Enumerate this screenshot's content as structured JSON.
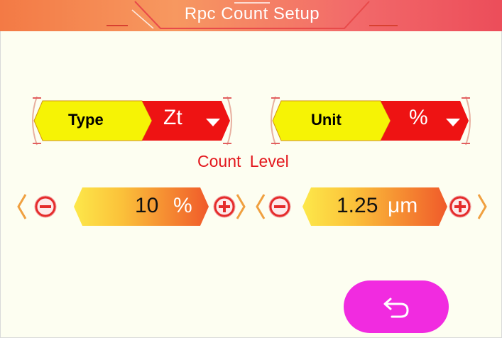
{
  "header": {
    "title": "Rpc  Count  Setup"
  },
  "type_selector": {
    "label": "Type",
    "value": "Zt"
  },
  "unit_selector": {
    "label": "Unit",
    "value": "%"
  },
  "section_label": "Count  Level",
  "percent_stepper": {
    "value": "10",
    "unit": "%"
  },
  "micron_stepper": {
    "value": "1.25",
    "unit": "μm"
  },
  "colors": {
    "title_bar": "#f48b5c",
    "label_fill": "#f6f305",
    "value_fill": "#ee1313",
    "accent_red": "#e3161c",
    "back_button": "#f12be0",
    "background": "#fdfef1"
  },
  "icons": {
    "dropdown": "triangle-down-icon",
    "decrement": "minus-circle-icon",
    "increment": "plus-circle-icon",
    "back": "return-arrow-icon"
  }
}
